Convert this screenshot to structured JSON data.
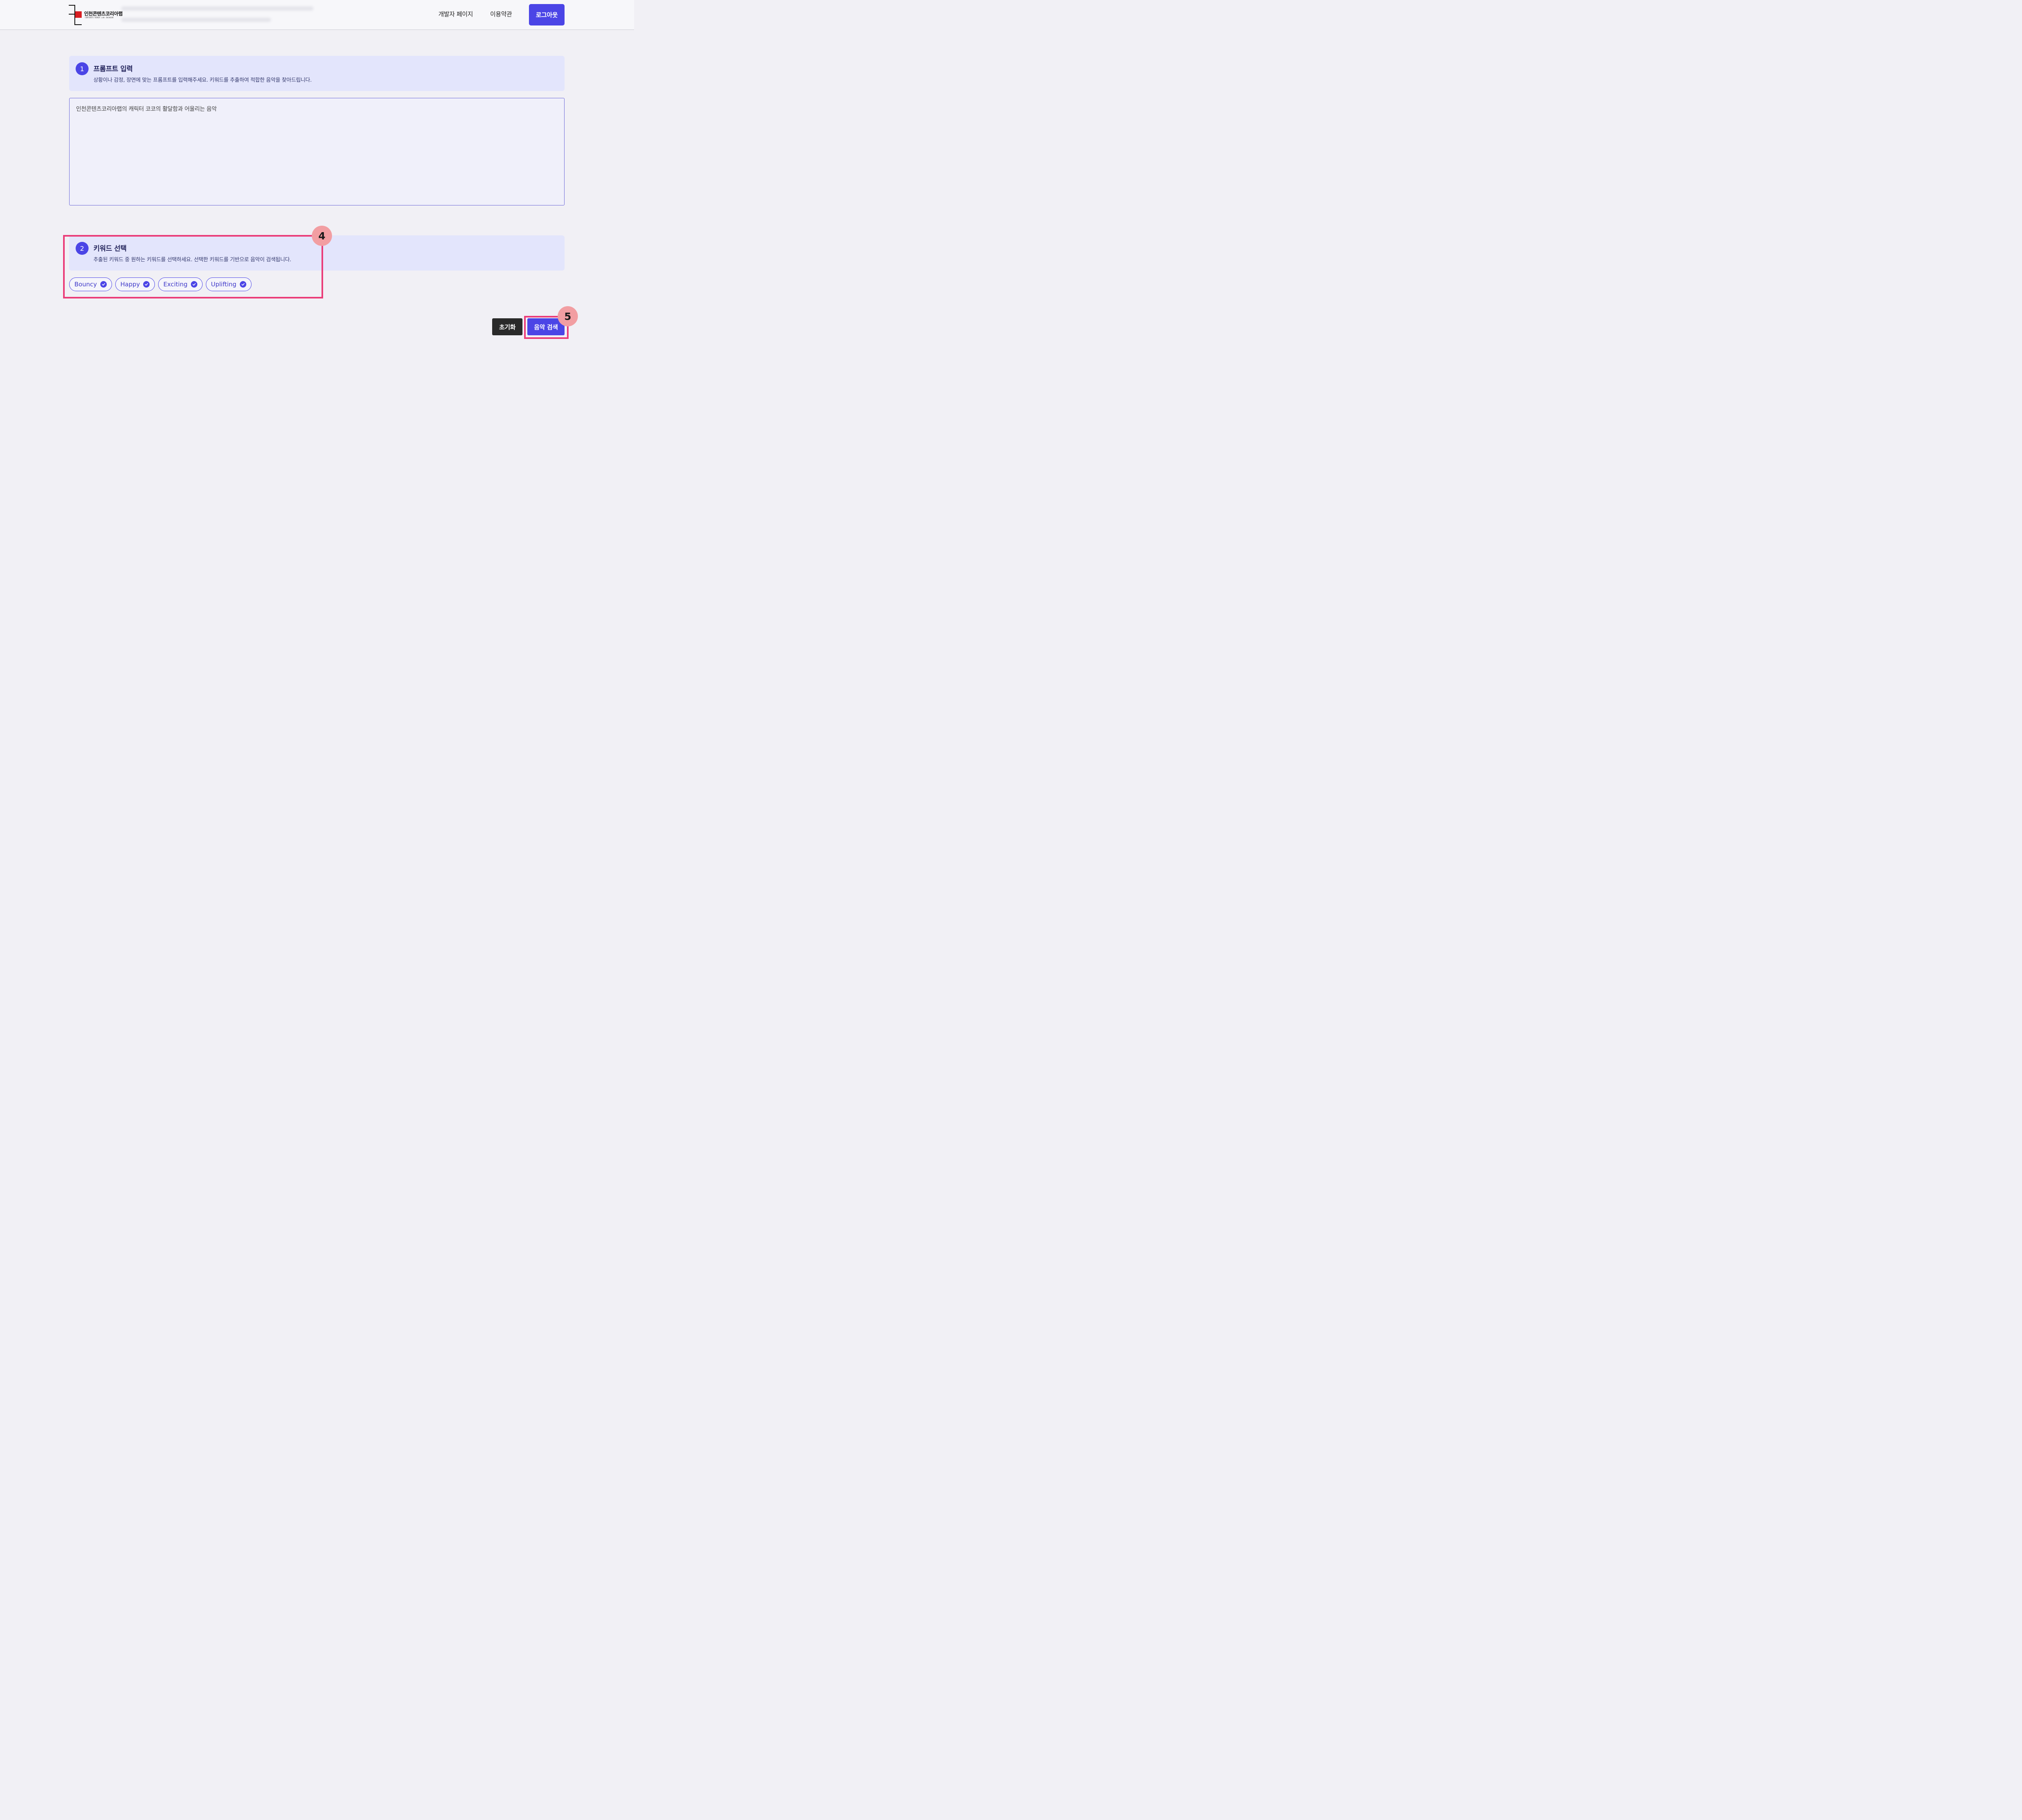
{
  "header": {
    "logo_name": "인천콘텐츠코리아랩",
    "logo_sub": "CONTENTS KOREA LAB INCHEON",
    "nav": [
      {
        "label": "개발자 페이지"
      },
      {
        "label": "이용약관"
      }
    ],
    "logout_label": "로그아웃"
  },
  "prompt_section": {
    "step": "1",
    "title": "프롬프트 입력",
    "description": "상황이나 감정, 장면에 맞는 프롬프트를 입력해주세요. 키워드를 추출하여 적합한 음악을 찾아드립니다.",
    "value": "인천콘텐츠코리아랩의 캐릭터 코코의 활달함과 어울리는 음악"
  },
  "keyword_section": {
    "step": "2",
    "title": "키워드 선택",
    "description": "추출된 키워드 중 원하는 키워드를 선택하세요. 선택한 키워드를 기반으로 음악이 검색됩니다.",
    "keywords": [
      {
        "label": "Bouncy",
        "selected": true
      },
      {
        "label": "Happy",
        "selected": true
      },
      {
        "label": "Exciting",
        "selected": true
      },
      {
        "label": "Uplifting",
        "selected": true
      }
    ]
  },
  "actions": {
    "reset_label": "초기화",
    "search_label": "음악 검색"
  },
  "annotations": {
    "badge_keywords": "4",
    "badge_search": "5",
    "highlight_color": "#ea3c78"
  },
  "colors": {
    "accent": "#4b45e6",
    "card_bg": "#e3e5fc"
  }
}
